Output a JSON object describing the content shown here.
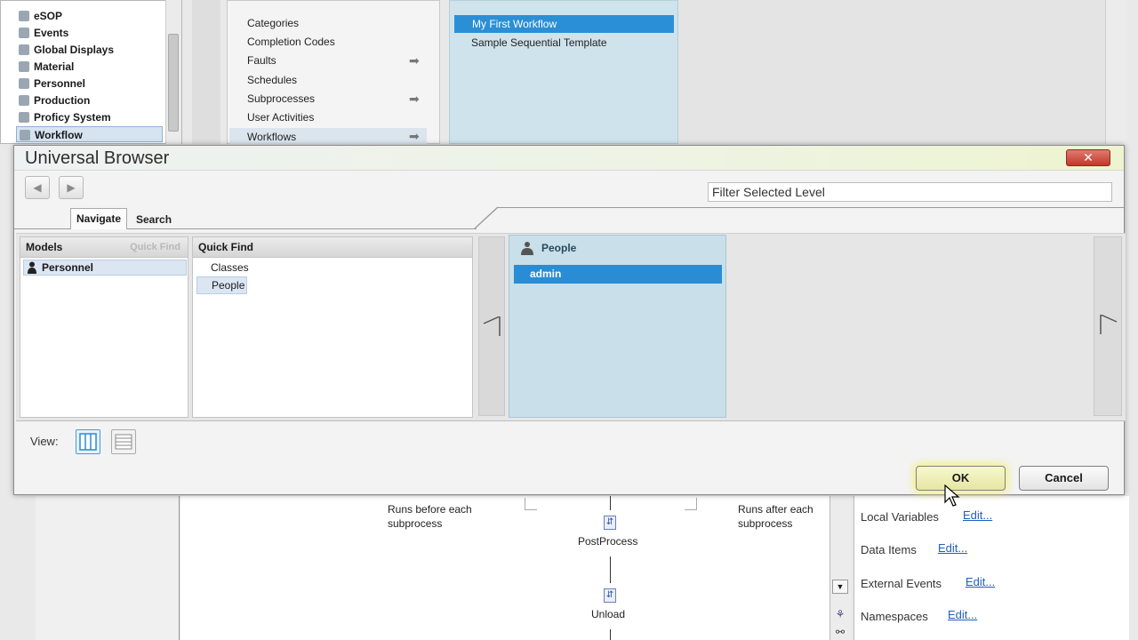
{
  "background": {
    "models": [
      "eSOP",
      "Events",
      "Global Displays",
      "Material",
      "Personnel",
      "Production",
      "Proficy System",
      "Workflow"
    ],
    "selected_model": "Workflow",
    "categories": [
      "Categories",
      "Completion Codes",
      "Faults",
      "Schedules",
      "Subprocesses",
      "User Activities",
      "Workflows"
    ],
    "workflows": {
      "selected": "My First Workflow",
      "other": "Sample Sequential Template"
    },
    "diagram": {
      "before_note": "Runs before each subprocess",
      "after_note": "Runs after each subprocess",
      "nodes": [
        "PostProcess",
        "Unload"
      ]
    },
    "properties": [
      {
        "label": "Local Variables",
        "action": "Edit..."
      },
      {
        "label": "Data Items",
        "action": "Edit..."
      },
      {
        "label": "External Events",
        "action": "Edit..."
      },
      {
        "label": "Namespaces",
        "action": "Edit..."
      }
    ]
  },
  "dialog": {
    "title": "Universal Browser",
    "close_glyph": "✕",
    "back_glyph": "◀",
    "forward_glyph": "▶",
    "filter_placeholder": "Filter Selected Level",
    "tabs": {
      "navigate": "Navigate",
      "search": "Search"
    },
    "columns": {
      "models": {
        "header": "Models",
        "hint": "Quick Find",
        "items": [
          "Personnel"
        ]
      },
      "quick_find": {
        "header": "Quick Find",
        "items": [
          "Classes",
          "People"
        ],
        "selected": "People"
      },
      "people": {
        "header": "People",
        "items": [
          "admin"
        ],
        "selected": "admin"
      }
    },
    "view_label": "View:",
    "buttons": {
      "ok": "OK",
      "cancel": "Cancel"
    },
    "colors": {
      "selection": "#2a8cd3",
      "people_panel": "#c9dfe9",
      "ok_glow": "#f5f050"
    }
  }
}
